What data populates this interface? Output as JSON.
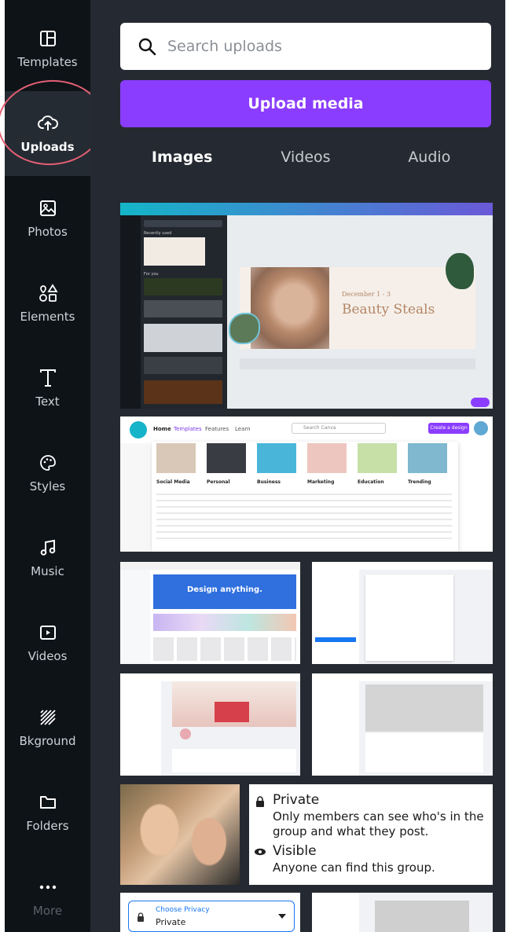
{
  "sidebar": {
    "items": [
      {
        "label": "Templates",
        "icon": "templates-icon"
      },
      {
        "label": "Uploads",
        "icon": "upload-cloud-icon"
      },
      {
        "label": "Photos",
        "icon": "photos-icon"
      },
      {
        "label": "Elements",
        "icon": "elements-icon"
      },
      {
        "label": "Text",
        "icon": "text-icon"
      },
      {
        "label": "Styles",
        "icon": "palette-icon"
      },
      {
        "label": "Music",
        "icon": "music-note-icon"
      },
      {
        "label": "Videos",
        "icon": "video-play-icon"
      },
      {
        "label": "Bkground",
        "icon": "background-pattern-icon"
      },
      {
        "label": "Folders",
        "icon": "folder-icon"
      },
      {
        "label": "More",
        "icon": "more-dots-icon"
      }
    ],
    "active": "Uploads"
  },
  "panel": {
    "search_placeholder": "Search uploads",
    "upload_button": "Upload media",
    "tabs": [
      "Images",
      "Videos",
      "Audio"
    ],
    "active_tab": "Images"
  },
  "thumbnails": {
    "beauty": {
      "title": "Beauty Steals",
      "subtitle": "December 1 - 3",
      "recently_used": "Recently used",
      "for_you": "For you"
    },
    "menu": {
      "home": "Home",
      "templates": "Templates",
      "features": "Features",
      "learn": "Learn",
      "search": "Search Canva",
      "create": "Create a design",
      "columns": [
        "Social Media",
        "Personal",
        "Business",
        "Marketing",
        "Education",
        "Trending"
      ]
    },
    "design_anything": "Design anything.",
    "group_card": {
      "private_title": "Private",
      "private_desc": "Only members can see who's in the group and what they post.",
      "visible_title": "Visible",
      "visible_desc": "Anyone can find this group."
    },
    "privacy": {
      "label": "Choose Privacy",
      "value": "Private"
    }
  },
  "colors": {
    "accent": "#8b3dff",
    "sidebar_bg": "#0e1318",
    "panel_bg": "#252a32",
    "highlight": "#e35f73"
  }
}
